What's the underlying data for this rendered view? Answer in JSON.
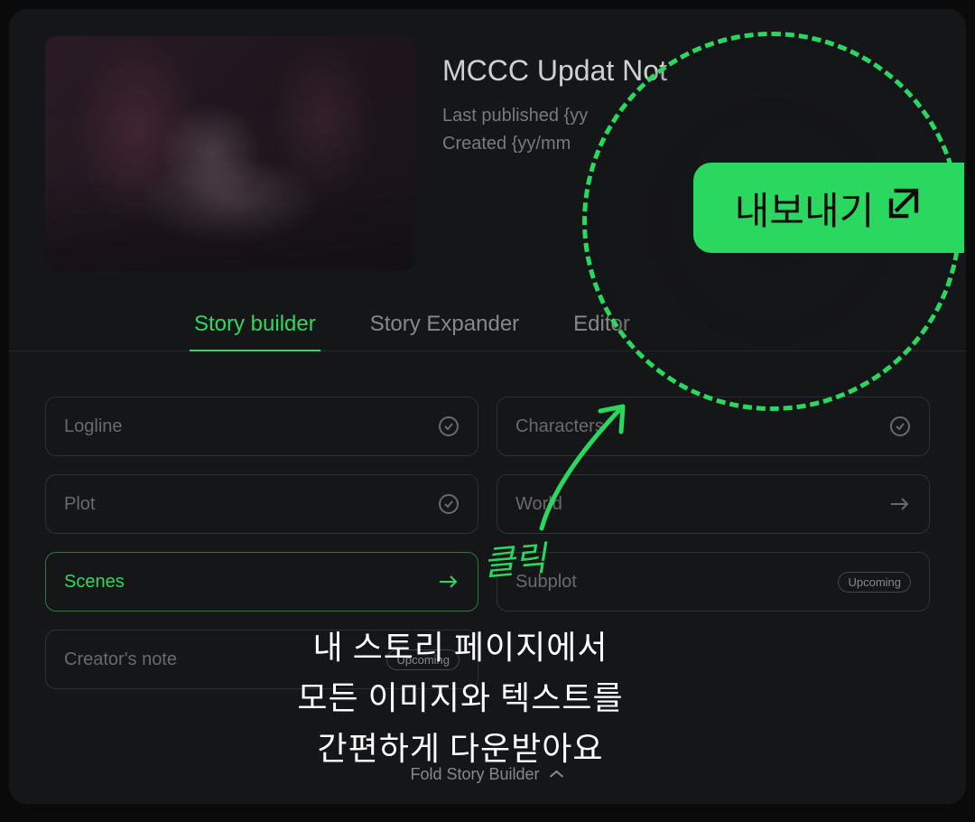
{
  "header": {
    "title": "MCCC Updat Not",
    "last_published_label": "Last published {yy",
    "created_label": "Created {yy/mm"
  },
  "tabs": {
    "story_builder": "Story builder",
    "story_expander": "Story Expander",
    "editor": "Editor"
  },
  "cards": {
    "logline": "Logline",
    "characters": "Characters",
    "plot": "Plot",
    "world": "World",
    "scenes": "Scenes",
    "subplot": "Subplot",
    "creators_note": "Creator's note",
    "upcoming_badge": "Upcoming"
  },
  "fold_button": "Fold Story Builder",
  "export_button": "내보내기",
  "annotations": {
    "click": "클릭",
    "description_line1": "내 스토리 페이지에서",
    "description_line2": "모든 이미지와 텍스트를",
    "description_line3": "간편하게 다운받아요"
  },
  "colors": {
    "accent": "#2bd85f",
    "background": "#151618"
  }
}
